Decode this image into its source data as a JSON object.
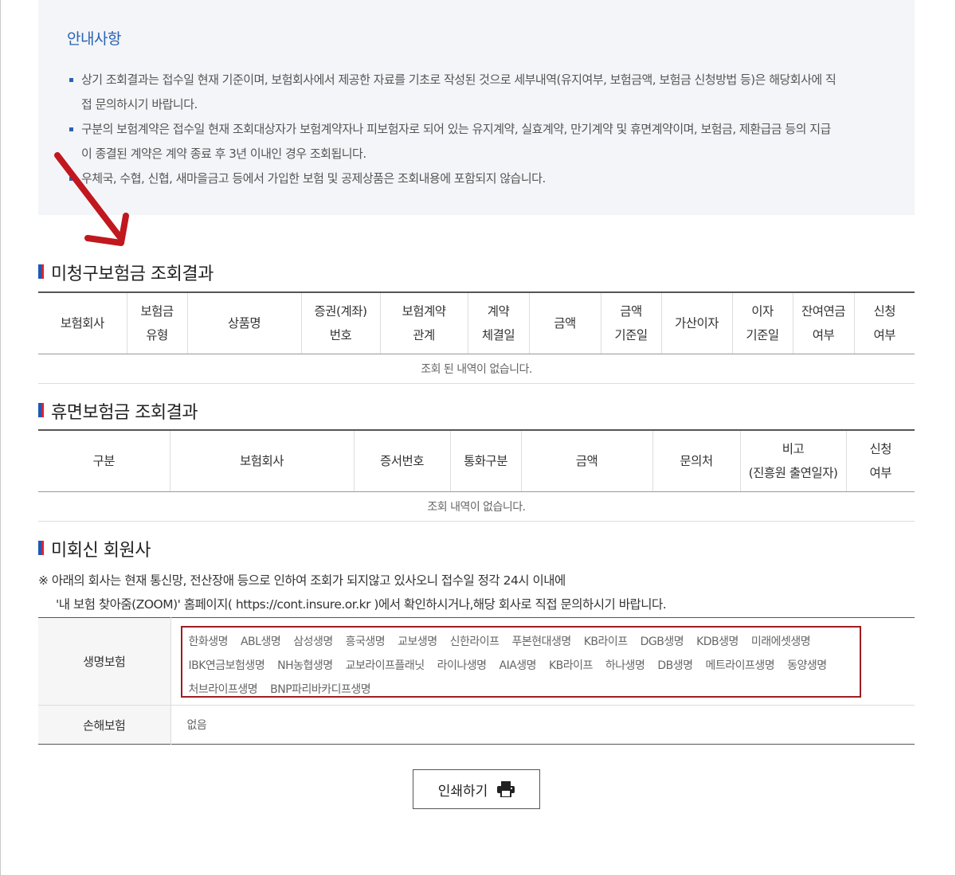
{
  "notice": {
    "title": "안내사항",
    "items": [
      "상기 조회결과는 접수일 현재 기준이며, 보험회사에서 제공한 자료를 기초로 작성된 것으로 세부내역(유지여부, 보험금액, 보험금 신청방법 등)은 해당회사에 직",
      "접 문의하시기 바랍니다.",
      "구분의 보험계약은 접수일 현재 조회대상자가 보험계약자나 피보험자로 되어 있는 유지계약, 실효계약, 만기계약 및 휴면계약이며, 보험금, 제환급금 등의 지급",
      "이 종결된 계약은 계약 종료 후 3년 이내인 경우 조회됩니다.",
      "우체국, 수협, 신협, 새마을금고 등에서 가입한 보험 및 공제상품은 조회내용에 포함되지 않습니다."
    ]
  },
  "unclaimed": {
    "title": "미청구보험금 조회결과",
    "headers": [
      [
        "보험회사"
      ],
      [
        "보험금",
        "유형"
      ],
      [
        "상품명"
      ],
      [
        "증권(계좌)",
        "번호"
      ],
      [
        "보험계약",
        "관계"
      ],
      [
        "계약",
        "체결일"
      ],
      [
        "금액"
      ],
      [
        "금액",
        "기준일"
      ],
      [
        "가산이자"
      ],
      [
        "이자",
        "기준일"
      ],
      [
        "잔여연금",
        "여부"
      ],
      [
        "신청",
        "여부"
      ]
    ],
    "empty": "조회 된 내역이 없습니다."
  },
  "dormant": {
    "title": "휴면보험금 조회결과",
    "headers": [
      [
        "구분"
      ],
      [
        "보험회사"
      ],
      [
        "증서번호"
      ],
      [
        "통화구분"
      ],
      [
        "금액"
      ],
      [
        "문의처"
      ],
      [
        "비고",
        "(진흥원 출연일자)"
      ],
      [
        "신청",
        "여부"
      ]
    ],
    "empty": "조회 내역이 없습니다."
  },
  "unreplied": {
    "title": "미회신 회원사",
    "note_line1": "※ 아래의 회사는 현재 통신망, 전산장애 등으로 인하여 조회가 되지않고 있사오니 접수일 정각 24시 이내에",
    "note_line2": "'내 보험 찾아줌(ZOOM)' 홈페이지( https://cont.insure.or.kr )에서 확인하시거나,해당 회사로 직접 문의하시기 바랍니다.",
    "life_label": "생명보험",
    "life_companies": [
      "한화생명",
      "ABL생명",
      "삼성생명",
      "흥국생명",
      "교보생명",
      "신한라이프",
      "푸본현대생명",
      "KB라이프",
      "DGB생명",
      "KDB생명",
      "미래에셋생명",
      "IBK연금보험생명",
      "NH농협생명",
      "교보라이프플래닛",
      "라이나생명",
      "AIA생명",
      "KB라이프",
      "하나생명",
      "DB생명",
      "메트라이프생명",
      "동양생명",
      "처브라이프생명",
      "BNP파리바카디프생명"
    ],
    "nonlife_label": "손해보험",
    "nonlife_value": "없음"
  },
  "print_button": "인쇄하기",
  "colors": {
    "accent_blue": "#2b62b4",
    "highlight_red": "#a01c22",
    "notice_bg": "#f3f5f8"
  },
  "icons": [
    "arrow-annotation",
    "printer-icon"
  ]
}
